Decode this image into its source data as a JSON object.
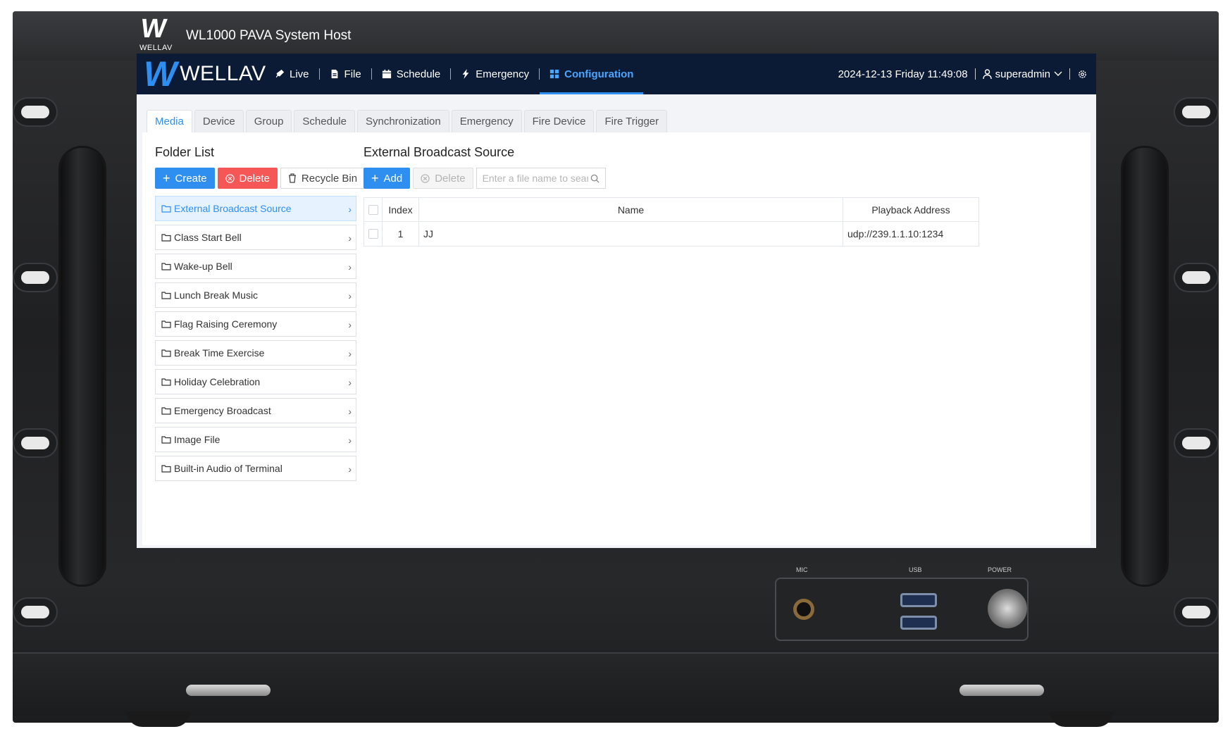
{
  "window": {
    "logo_small": "W",
    "logo_small_text": "WELLAV",
    "title": "WL1000 PAVA System Host"
  },
  "topbar": {
    "brand_mark": "W",
    "brand_text": "WELLAV",
    "nav": [
      {
        "label": "Live",
        "icon": "rocket-icon"
      },
      {
        "label": "File",
        "icon": "file-icon"
      },
      {
        "label": "Schedule",
        "icon": "calendar-icon"
      },
      {
        "label": "Emergency",
        "icon": "bolt-icon"
      },
      {
        "label": "Configuration",
        "icon": "grid-icon",
        "active": true
      }
    ],
    "datetime": "2024-12-13 Friday 11:49:08",
    "user": "superadmin"
  },
  "tabs": [
    "Media",
    "Device",
    "Group",
    "Schedule",
    "Synchronization",
    "Emergency",
    "Fire Device",
    "Fire Trigger"
  ],
  "folder_panel": {
    "title": "Folder List",
    "create_label": "Create",
    "delete_label": "Delete",
    "recycle_label": "Recycle Bin",
    "folders": [
      "External Broadcast Source",
      "Class Start Bell",
      "Wake-up Bell",
      "Lunch Break Music",
      "Flag Raising Ceremony",
      "Break Time Exercise",
      "Holiday Celebration",
      "Emergency Broadcast",
      "Image File",
      "Built-in Audio of Terminal"
    ]
  },
  "source_panel": {
    "title": "External Broadcast Source",
    "add_label": "Add",
    "delete_label": "Delete",
    "search_placeholder": "Enter a file name to search.",
    "columns": [
      "Index",
      "Name",
      "Playback Address"
    ],
    "rows": [
      {
        "index": "1",
        "name": "JJ",
        "address": "udp://239.1.1.10:1234"
      }
    ]
  },
  "hardware": {
    "mic_label": "MIC",
    "usb_label": "USB",
    "power_label": "POWER"
  },
  "colors": {
    "primary": "#2f8ff0",
    "danger": "#f55656",
    "topbar": "#0b1a35"
  }
}
